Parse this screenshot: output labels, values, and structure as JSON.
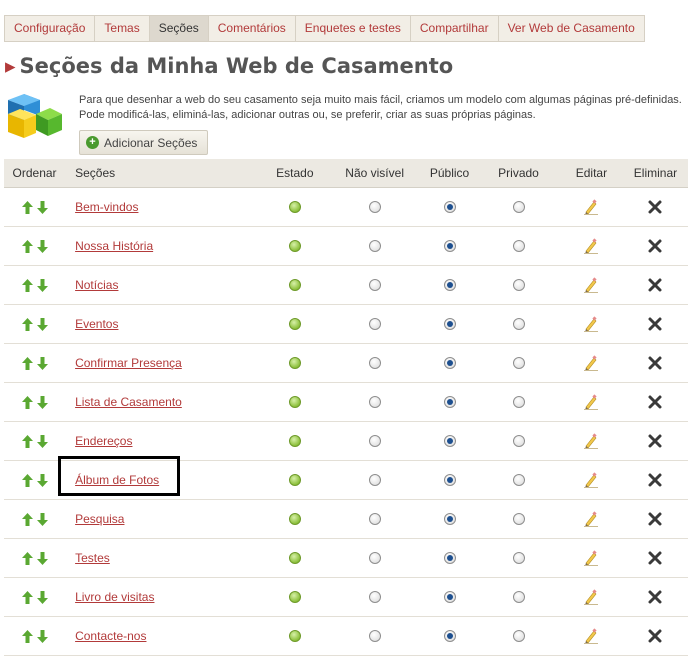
{
  "tabs": [
    {
      "label": "Configuração",
      "active": false
    },
    {
      "label": "Temas",
      "active": false
    },
    {
      "label": "Seções",
      "active": true
    },
    {
      "label": "Comentários",
      "active": false
    },
    {
      "label": "Enquetes e testes",
      "active": false
    },
    {
      "label": "Compartilhar",
      "active": false
    },
    {
      "label": "Ver Web de Casamento",
      "active": false
    }
  ],
  "page": {
    "title": "Seções da Minha Web de Casamento",
    "intro": "Para que desenhar a web do seu casamento seja muito mais fácil, criamos um modelo com algumas páginas pré-definidas. Pode modificá-las, eliminá-las, adicionar outras ou, se preferir, criar as suas próprias páginas.",
    "add_button": "Adicionar Seções"
  },
  "table": {
    "headers": {
      "order": "Ordenar",
      "sections": "Seções",
      "state": "Estado",
      "not_visible": "Não visível",
      "public": "Público",
      "private": "Privado",
      "edit": "Editar",
      "delete": "Eliminar"
    },
    "rows": [
      {
        "name": "Bem-vindos",
        "visibility": "public"
      },
      {
        "name": "Nossa História",
        "visibility": "public"
      },
      {
        "name": "Notícias",
        "visibility": "public"
      },
      {
        "name": "Eventos",
        "visibility": "public"
      },
      {
        "name": "Confirmar Presença",
        "visibility": "public"
      },
      {
        "name": "Lista de Casamento",
        "visibility": "public"
      },
      {
        "name": "Endereços",
        "visibility": "public"
      },
      {
        "name": "Álbum de Fotos",
        "visibility": "public"
      },
      {
        "name": "Pesquisa",
        "visibility": "public"
      },
      {
        "name": "Testes",
        "visibility": "public"
      },
      {
        "name": "Livro de visitas",
        "visibility": "public"
      },
      {
        "name": "Contacte-nos",
        "visibility": "public"
      }
    ]
  },
  "colors": {
    "link": "#b23a3a",
    "status_active": "#8bbf3a",
    "arrow": "#5aa832"
  },
  "icons": {
    "up": "arrow-up-icon",
    "down": "arrow-down-icon",
    "state": "status-dot-icon",
    "edit": "pencil-icon",
    "delete": "delete-x-icon",
    "add": "plus-icon",
    "logo": "blocks-icon"
  }
}
